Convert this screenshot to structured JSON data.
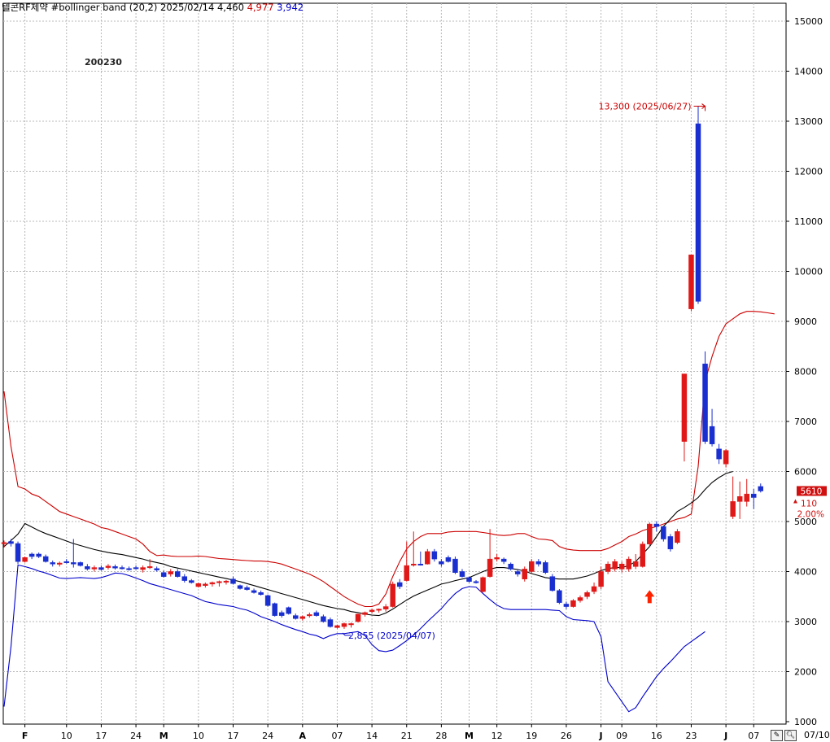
{
  "header": {
    "title": "텔콘RF제약 #bollinger band",
    "params": "(20,2)",
    "date": "2025/02/14",
    "mid_value": "4,460",
    "upper_value": "4,977",
    "lower_value": "3,942",
    "colors": {
      "upper": "#cc0000",
      "lower": "#0000cc",
      "mid": "#000000"
    }
  },
  "stock_code": "200230",
  "last_date_label": "07/10",
  "toolbar": {
    "edit_icon": "pencil-icon",
    "zoom_icon": "magnifier-icon"
  },
  "chart_data": {
    "type": "candlestick",
    "ylim": [
      1000,
      15500
    ],
    "y_ticks": [
      1000,
      2000,
      3000,
      4000,
      5000,
      6000,
      7000,
      8000,
      9000,
      10000,
      11000,
      12000,
      13000,
      14000,
      15000
    ],
    "y_tick_labels": [
      "1000",
      "2000",
      "3000",
      "4000",
      "5000",
      "6000",
      "7000",
      "8000",
      "9000",
      "10000",
      "11000",
      "12000",
      "13000",
      "14000",
      "15000"
    ],
    "grid": true,
    "x_tick_labels": [
      {
        "i": 3,
        "label": "F"
      },
      {
        "i": 9,
        "label": "10"
      },
      {
        "i": 14,
        "label": "17"
      },
      {
        "i": 19,
        "label": "24"
      },
      {
        "i": 23,
        "label": "M"
      },
      {
        "i": 28,
        "label": "10"
      },
      {
        "i": 33,
        "label": "17"
      },
      {
        "i": 38,
        "label": "24"
      },
      {
        "i": 43,
        "label": "A"
      },
      {
        "i": 48,
        "label": "07"
      },
      {
        "i": 53,
        "label": "14"
      },
      {
        "i": 58,
        "label": "21"
      },
      {
        "i": 63,
        "label": "28"
      },
      {
        "i": 67,
        "label": "M"
      },
      {
        "i": 71,
        "label": "12"
      },
      {
        "i": 76,
        "label": "19"
      },
      {
        "i": 81,
        "label": "26"
      },
      {
        "i": 86,
        "label": "J"
      },
      {
        "i": 89,
        "label": "09"
      },
      {
        "i": 94,
        "label": "16"
      },
      {
        "i": 99,
        "label": "23"
      },
      {
        "i": 104,
        "label": "J"
      },
      {
        "i": 108,
        "label": "07"
      }
    ],
    "candles": [
      {
        "o": 4560,
        "h": 4620,
        "l": 4480,
        "c": 4580
      },
      {
        "o": 4600,
        "h": 4650,
        "l": 4500,
        "c": 4560
      },
      {
        "o": 4560,
        "h": 4600,
        "l": 4150,
        "c": 4200
      },
      {
        "o": 4200,
        "h": 4300,
        "l": 4180,
        "c": 4280
      },
      {
        "o": 4350,
        "h": 4380,
        "l": 4250,
        "c": 4300
      },
      {
        "o": 4350,
        "h": 4380,
        "l": 4270,
        "c": 4300
      },
      {
        "o": 4300,
        "h": 4340,
        "l": 4180,
        "c": 4200
      },
      {
        "o": 4180,
        "h": 4220,
        "l": 4100,
        "c": 4150
      },
      {
        "o": 4160,
        "h": 4200,
        "l": 4100,
        "c": 4170
      },
      {
        "o": 4200,
        "h": 4250,
        "l": 4160,
        "c": 4180
      },
      {
        "o": 4180,
        "h": 4650,
        "l": 4080,
        "c": 4150
      },
      {
        "o": 4180,
        "h": 4200,
        "l": 4100,
        "c": 4120
      },
      {
        "o": 4100,
        "h": 4150,
        "l": 4020,
        "c": 4050
      },
      {
        "o": 4050,
        "h": 4120,
        "l": 4000,
        "c": 4080
      },
      {
        "o": 4080,
        "h": 4120,
        "l": 4020,
        "c": 4040
      },
      {
        "o": 4080,
        "h": 4150,
        "l": 4040,
        "c": 4110
      },
      {
        "o": 4100,
        "h": 4140,
        "l": 4040,
        "c": 4070
      },
      {
        "o": 4080,
        "h": 4120,
        "l": 4040,
        "c": 4060
      },
      {
        "o": 4060,
        "h": 4100,
        "l": 4020,
        "c": 4050
      },
      {
        "o": 4080,
        "h": 4120,
        "l": 4040,
        "c": 4060
      },
      {
        "o": 4040,
        "h": 4120,
        "l": 3980,
        "c": 4080
      },
      {
        "o": 4080,
        "h": 4250,
        "l": 4050,
        "c": 4100
      },
      {
        "o": 4060,
        "h": 4100,
        "l": 4000,
        "c": 4030
      },
      {
        "o": 3980,
        "h": 4020,
        "l": 3880,
        "c": 3900
      },
      {
        "o": 3950,
        "h": 4050,
        "l": 3900,
        "c": 4000
      },
      {
        "o": 4000,
        "h": 4050,
        "l": 3880,
        "c": 3900
      },
      {
        "o": 3900,
        "h": 3950,
        "l": 3780,
        "c": 3820
      },
      {
        "o": 3820,
        "h": 3850,
        "l": 3760,
        "c": 3780
      },
      {
        "o": 3700,
        "h": 3780,
        "l": 3680,
        "c": 3760
      },
      {
        "o": 3720,
        "h": 3780,
        "l": 3680,
        "c": 3750
      },
      {
        "o": 3750,
        "h": 3800,
        "l": 3700,
        "c": 3780
      },
      {
        "o": 3780,
        "h": 3820,
        "l": 3700,
        "c": 3800
      },
      {
        "o": 3790,
        "h": 3830,
        "l": 3740,
        "c": 3810
      },
      {
        "o": 3850,
        "h": 3900,
        "l": 3740,
        "c": 3760
      },
      {
        "o": 3720,
        "h": 3740,
        "l": 3640,
        "c": 3660
      },
      {
        "o": 3680,
        "h": 3720,
        "l": 3620,
        "c": 3640
      },
      {
        "o": 3620,
        "h": 3660,
        "l": 3560,
        "c": 3580
      },
      {
        "o": 3580,
        "h": 3620,
        "l": 3520,
        "c": 3540
      },
      {
        "o": 3520,
        "h": 3540,
        "l": 3300,
        "c": 3320
      },
      {
        "o": 3360,
        "h": 3380,
        "l": 3100,
        "c": 3120
      },
      {
        "o": 3180,
        "h": 3220,
        "l": 3080,
        "c": 3120
      },
      {
        "o": 3280,
        "h": 3300,
        "l": 3140,
        "c": 3160
      },
      {
        "o": 3120,
        "h": 3160,
        "l": 3040,
        "c": 3060
      },
      {
        "o": 3060,
        "h": 3120,
        "l": 3020,
        "c": 3100
      },
      {
        "o": 3120,
        "h": 3180,
        "l": 3080,
        "c": 3140
      },
      {
        "o": 3180,
        "h": 3220,
        "l": 3100,
        "c": 3120
      },
      {
        "o": 3100,
        "h": 3140,
        "l": 2980,
        "c": 3000
      },
      {
        "o": 3040,
        "h": 3080,
        "l": 2880,
        "c": 2900
      },
      {
        "o": 2880,
        "h": 2940,
        "l": 2860,
        "c": 2920
      },
      {
        "o": 2900,
        "h": 2980,
        "l": 2855,
        "c": 2960
      },
      {
        "o": 2940,
        "h": 2980,
        "l": 2880,
        "c": 2960
      },
      {
        "o": 3000,
        "h": 3160,
        "l": 2980,
        "c": 3150
      },
      {
        "o": 3140,
        "h": 3200,
        "l": 3100,
        "c": 3180
      },
      {
        "o": 3200,
        "h": 3260,
        "l": 3160,
        "c": 3230
      },
      {
        "o": 3230,
        "h": 3260,
        "l": 3180,
        "c": 3250
      },
      {
        "o": 3250,
        "h": 3350,
        "l": 3200,
        "c": 3300
      },
      {
        "o": 3300,
        "h": 3800,
        "l": 3280,
        "c": 3750
      },
      {
        "o": 3780,
        "h": 3850,
        "l": 3650,
        "c": 3700
      },
      {
        "o": 3820,
        "h": 4600,
        "l": 3800,
        "c": 4120
      },
      {
        "o": 4150,
        "h": 4800,
        "l": 4100,
        "c": 4150
      },
      {
        "o": 4150,
        "h": 4400,
        "l": 4120,
        "c": 4140
      },
      {
        "o": 4150,
        "h": 4450,
        "l": 4140,
        "c": 4400
      },
      {
        "o": 4400,
        "h": 4450,
        "l": 4200,
        "c": 4250
      },
      {
        "o": 4200,
        "h": 4250,
        "l": 4100,
        "c": 4150
      },
      {
        "o": 4280,
        "h": 4320,
        "l": 4180,
        "c": 4200
      },
      {
        "o": 4250,
        "h": 4300,
        "l": 3950,
        "c": 3980
      },
      {
        "o": 4000,
        "h": 4050,
        "l": 3880,
        "c": 3900
      },
      {
        "o": 3880,
        "h": 3900,
        "l": 3780,
        "c": 3800
      },
      {
        "o": 3800,
        "h": 3830,
        "l": 3760,
        "c": 3780
      },
      {
        "o": 3600,
        "h": 3900,
        "l": 3580,
        "c": 3880
      },
      {
        "o": 3900,
        "h": 4850,
        "l": 3880,
        "c": 4250
      },
      {
        "o": 4250,
        "h": 4350,
        "l": 4200,
        "c": 4280
      },
      {
        "o": 4250,
        "h": 4280,
        "l": 4150,
        "c": 4200
      },
      {
        "o": 4150,
        "h": 4180,
        "l": 4020,
        "c": 4050
      },
      {
        "o": 4000,
        "h": 4050,
        "l": 3900,
        "c": 3950
      },
      {
        "o": 3850,
        "h": 4100,
        "l": 3800,
        "c": 4050
      },
      {
        "o": 4000,
        "h": 4250,
        "l": 3950,
        "c": 4200
      },
      {
        "o": 4200,
        "h": 4250,
        "l": 4100,
        "c": 4150
      },
      {
        "o": 4180,
        "h": 4220,
        "l": 3950,
        "c": 3980
      },
      {
        "o": 3900,
        "h": 3950,
        "l": 3600,
        "c": 3620
      },
      {
        "o": 3620,
        "h": 3650,
        "l": 3350,
        "c": 3380
      },
      {
        "o": 3350,
        "h": 3400,
        "l": 3250,
        "c": 3300
      },
      {
        "o": 3300,
        "h": 3450,
        "l": 3280,
        "c": 3420
      },
      {
        "o": 3420,
        "h": 3520,
        "l": 3380,
        "c": 3480
      },
      {
        "o": 3500,
        "h": 3620,
        "l": 3450,
        "c": 3580
      },
      {
        "o": 3600,
        "h": 3780,
        "l": 3550,
        "c": 3700
      },
      {
        "o": 3700,
        "h": 4100,
        "l": 3650,
        "c": 4000
      },
      {
        "o": 4000,
        "h": 4200,
        "l": 3950,
        "c": 4150
      },
      {
        "o": 4050,
        "h": 4250,
        "l": 4000,
        "c": 4200
      },
      {
        "o": 4050,
        "h": 4200,
        "l": 3980,
        "c": 4150
      },
      {
        "o": 4050,
        "h": 4300,
        "l": 4000,
        "c": 4250
      },
      {
        "o": 4100,
        "h": 4350,
        "l": 4050,
        "c": 4200
      },
      {
        "o": 4100,
        "h": 4600,
        "l": 4080,
        "c": 4550
      },
      {
        "o": 4550,
        "h": 4980,
        "l": 4500,
        "c": 4950
      },
      {
        "o": 4950,
        "h": 5000,
        "l": 4800,
        "c": 4900
      },
      {
        "o": 4900,
        "h": 4920,
        "l": 4600,
        "c": 4650
      },
      {
        "o": 4700,
        "h": 4750,
        "l": 4400,
        "c": 4450
      },
      {
        "o": 4580,
        "h": 4850,
        "l": 4550,
        "c": 4800
      },
      {
        "o": 6600,
        "h": 7950,
        "l": 6200,
        "c": 7950
      },
      {
        "o": 9250,
        "h": 10330,
        "l": 9200,
        "c": 10330
      },
      {
        "o": 12950,
        "h": 13300,
        "l": 9350,
        "c": 9400
      },
      {
        "o": 8150,
        "h": 8400,
        "l": 6550,
        "c": 6600
      },
      {
        "o": 6900,
        "h": 7250,
        "l": 6500,
        "c": 6550
      },
      {
        "o": 6450,
        "h": 6550,
        "l": 6150,
        "c": 6250
      },
      {
        "o": 6150,
        "h": 6450,
        "l": 6080,
        "c": 6420
      },
      {
        "o": 5100,
        "h": 5900,
        "l": 5050,
        "c": 5400
      },
      {
        "o": 5400,
        "h": 5800,
        "l": 5050,
        "c": 5500
      },
      {
        "o": 5400,
        "h": 5850,
        "l": 5300,
        "c": 5550
      },
      {
        "o": 5550,
        "h": 5650,
        "l": 5250,
        "c": 5480
      },
      {
        "o": 5700,
        "h": 5760,
        "l": 5580,
        "c": 5610
      }
    ],
    "bollinger": {
      "period": 20,
      "k": 2,
      "upper": [
        7600,
        6500,
        5700,
        5650,
        5550,
        5500,
        5400,
        5300,
        5200,
        5150,
        5100,
        5050,
        5000,
        4950,
        4880,
        4850,
        4800,
        4750,
        4700,
        4650,
        4550,
        4400,
        4320,
        4330,
        4310,
        4300,
        4300,
        4300,
        4310,
        4300,
        4280,
        4260,
        4250,
        4240,
        4230,
        4220,
        4210,
        4210,
        4200,
        4180,
        4150,
        4100,
        4050,
        4000,
        3950,
        3880,
        3800,
        3700,
        3600,
        3500,
        3420,
        3350,
        3300,
        3300,
        3350,
        3550,
        3900,
        4200,
        4450,
        4600,
        4700,
        4760,
        4760,
        4760,
        4790,
        4800,
        4800,
        4800,
        4800,
        4780,
        4760,
        4730,
        4720,
        4730,
        4760,
        4760,
        4700,
        4650,
        4640,
        4620,
        4500,
        4450,
        4430,
        4420,
        4420,
        4420,
        4420,
        4460,
        4530,
        4600,
        4700,
        4750,
        4820,
        4860,
        4900,
        4950,
        5000,
        5050,
        5080,
        5150,
        6100,
        7800,
        8300,
        8700,
        8950,
        9050,
        9150,
        9200,
        9200,
        9190,
        9170,
        9150
      ],
      "mid": [
        4500,
        4620,
        4750,
        4960,
        4890,
        4820,
        4760,
        4710,
        4660,
        4610,
        4560,
        4520,
        4480,
        4440,
        4410,
        4380,
        4360,
        4340,
        4310,
        4280,
        4250,
        4210,
        4180,
        4150,
        4100,
        4070,
        4040,
        4010,
        3980,
        3950,
        3920,
        3890,
        3860,
        3830,
        3800,
        3760,
        3720,
        3680,
        3640,
        3600,
        3560,
        3520,
        3480,
        3440,
        3400,
        3360,
        3320,
        3290,
        3260,
        3240,
        3200,
        3180,
        3150,
        3130,
        3120,
        3170,
        3250,
        3340,
        3430,
        3510,
        3570,
        3630,
        3690,
        3750,
        3780,
        3820,
        3850,
        3880,
        3940,
        4000,
        4050,
        4080,
        4080,
        4060,
        4040,
        4010,
        3960,
        3920,
        3880,
        3860,
        3850,
        3850,
        3850,
        3880,
        3910,
        3960,
        4020,
        4060,
        4080,
        4080,
        4120,
        4200,
        4350,
        4500,
        4700,
        4900,
        5050,
        5200,
        5280,
        5370,
        5480,
        5640,
        5780,
        5880,
        5960,
        6000
      ],
      "lower": [
        1300,
        2500,
        4130,
        4100,
        4060,
        4010,
        3970,
        3920,
        3870,
        3860,
        3870,
        3880,
        3870,
        3860,
        3880,
        3920,
        3970,
        3960,
        3920,
        3870,
        3820,
        3760,
        3720,
        3680,
        3640,
        3600,
        3560,
        3520,
        3460,
        3400,
        3370,
        3340,
        3320,
        3300,
        3260,
        3230,
        3170,
        3100,
        3050,
        3000,
        2940,
        2890,
        2840,
        2800,
        2750,
        2720,
        2660,
        2720,
        2760,
        2760,
        2780,
        2800,
        2720,
        2540,
        2420,
        2400,
        2430,
        2520,
        2620,
        2730,
        2860,
        3000,
        3130,
        3260,
        3420,
        3560,
        3660,
        3700,
        3690,
        3560,
        3440,
        3330,
        3260,
        3240,
        3240,
        3240,
        3240,
        3240,
        3240,
        3230,
        3220,
        3100,
        3040,
        3030,
        3020,
        3000,
        2700,
        1800,
        1600,
        1400,
        1200,
        1280,
        1500,
        1700,
        1900,
        2060,
        2200,
        2350,
        2500,
        2600,
        2700,
        2800
      ]
    },
    "annotations": [
      {
        "label": "13,300 (2025/06/27)",
        "i": 101,
        "value": 13300,
        "color": "#cc0000"
      },
      {
        "label": "2,855 (2025/04/07)",
        "i": 49,
        "value": 2855,
        "color": "#0000cc"
      },
      {
        "type": "arrow-up",
        "i": 93,
        "value": 3400,
        "color": "#ff2200"
      }
    ],
    "last_price": {
      "value": "5610",
      "change": "110",
      "change_pct": "2.00%",
      "direction": "up"
    }
  }
}
